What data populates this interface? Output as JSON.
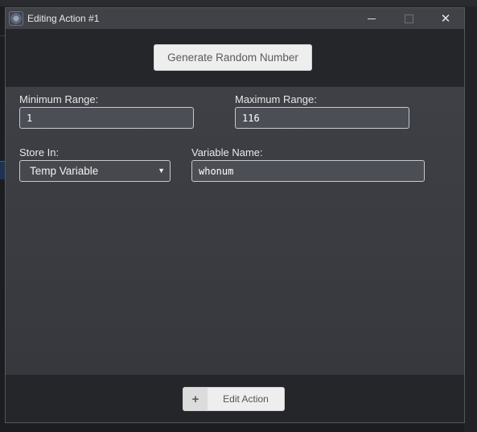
{
  "window": {
    "title": "Editing Action #1",
    "controls": {
      "minimize": "minimize",
      "maximize": "maximize",
      "close": "✕"
    }
  },
  "header": {
    "generate_label": "Generate Random Number"
  },
  "form": {
    "min_range": {
      "label": "Minimum Range:",
      "value": "1"
    },
    "max_range": {
      "label": "Maximum Range:",
      "value": "116"
    },
    "store_in": {
      "label": "Store In:",
      "selected": "Temp Variable"
    },
    "variable_name": {
      "label": "Variable Name:",
      "value": "whonum"
    }
  },
  "footer": {
    "edit_label": "Edit Action",
    "plus_glyph": "+"
  },
  "icons": {
    "app": "app-gear-icon",
    "minimize": "minimize-icon",
    "maximize": "maximize-icon",
    "close": "close-icon",
    "dropdown": "chevron-down-icon",
    "add": "plus-icon"
  },
  "colors": {
    "titlebar": "#404247",
    "panel": "#3e4046",
    "button_bg": "#eeeeee",
    "field_bg": "#4c4e55"
  }
}
